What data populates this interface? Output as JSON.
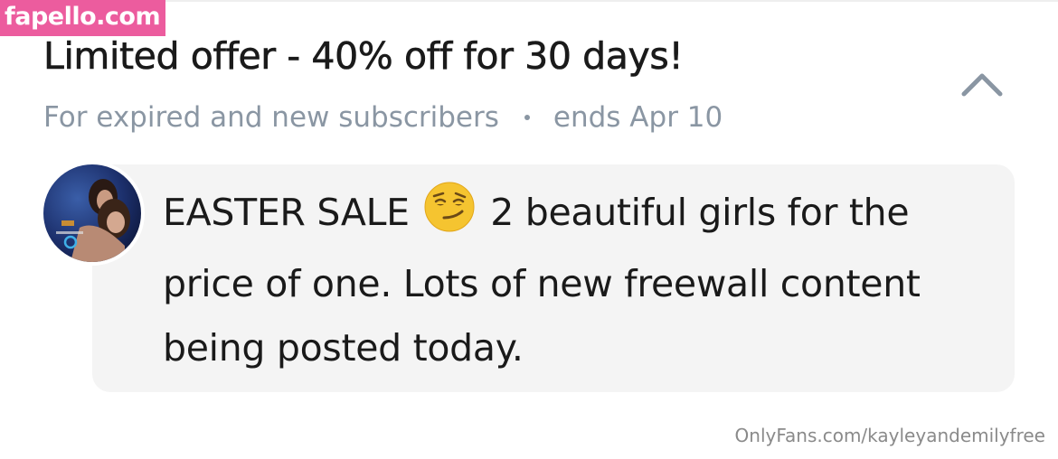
{
  "watermark": {
    "text": "fapello.com",
    "bg_color": "#ec5c9e"
  },
  "offer": {
    "title": "Limited offer - 40% off for 30 days!",
    "audience": "For expired and new subscribers",
    "separator": "•",
    "ends": "ends Apr 10"
  },
  "collapse": {
    "icon": "chevron-up-icon"
  },
  "avatar": {
    "icon": "profile-avatar"
  },
  "message": {
    "part1": "EASTER SALE",
    "emoji": "smirking-face-emoji",
    "part2": "2 beautiful girls for the price of one. Lots of new freewall content being posted today."
  },
  "footer": {
    "url": "OnlyFans.com/kayleyandemilyfree"
  },
  "colors": {
    "title": "#1a1a1a",
    "muted": "#8a96a3",
    "bubble": "#f4f4f4",
    "emoji": "#f5c430"
  }
}
